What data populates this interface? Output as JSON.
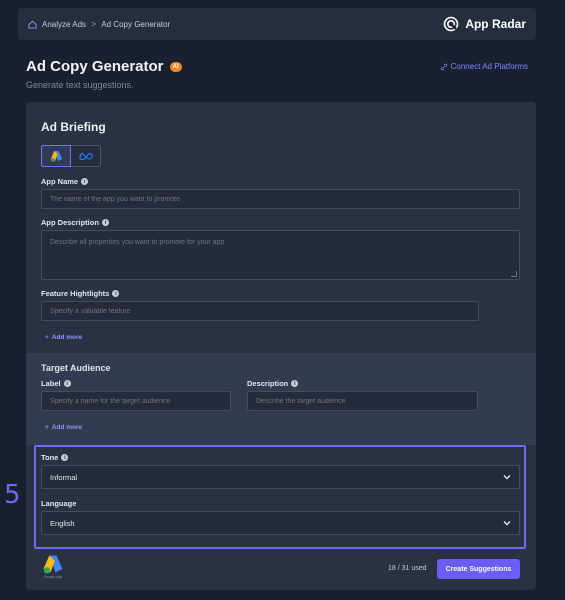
{
  "breadcrumb": {
    "items": [
      "Analyze Ads",
      "Ad Copy Generator"
    ],
    "separator": ">"
  },
  "brand": {
    "name": "App Radar"
  },
  "header": {
    "title": "Ad Copy Generator",
    "badge": "AI",
    "subtitle": "Generate text suggestions.",
    "connect_link": "Connect Ad Platforms"
  },
  "briefing": {
    "title": "Ad Briefing",
    "platforms": [
      {
        "icon": "google-ads-icon",
        "active": true
      },
      {
        "icon": "meta-icon",
        "active": false
      }
    ],
    "app_name": {
      "label": "App Name",
      "placeholder": "The name of the app you want to promote"
    },
    "app_description": {
      "label": "App Description",
      "placeholder": "Describe all properties you want to promote for your app"
    },
    "feature_highlights": {
      "label": "Feature Hightlights",
      "placeholder": "Specify a valuable feature",
      "add_more": "Add more"
    }
  },
  "target_audience": {
    "title": "Target Audience",
    "label_field": {
      "label": "Label",
      "placeholder": "Specify a name for the target audience"
    },
    "description_field": {
      "label": "Description",
      "placeholder": "Describe the target audience"
    },
    "add_more": "Add more"
  },
  "tone": {
    "label": "Tone",
    "value": "Informal"
  },
  "language": {
    "label": "Language",
    "value": "English"
  },
  "annotation": {
    "step": "5"
  },
  "footer": {
    "logo_caption": "Google Ads",
    "usage": "18 / 31 used",
    "create_button": "Create Suggestions"
  },
  "colors": {
    "accent": "#6a5cf5",
    "highlight": "#6a6cf5",
    "badge": "#f08a24",
    "background": "#1a2030",
    "card": "#2a3142"
  }
}
